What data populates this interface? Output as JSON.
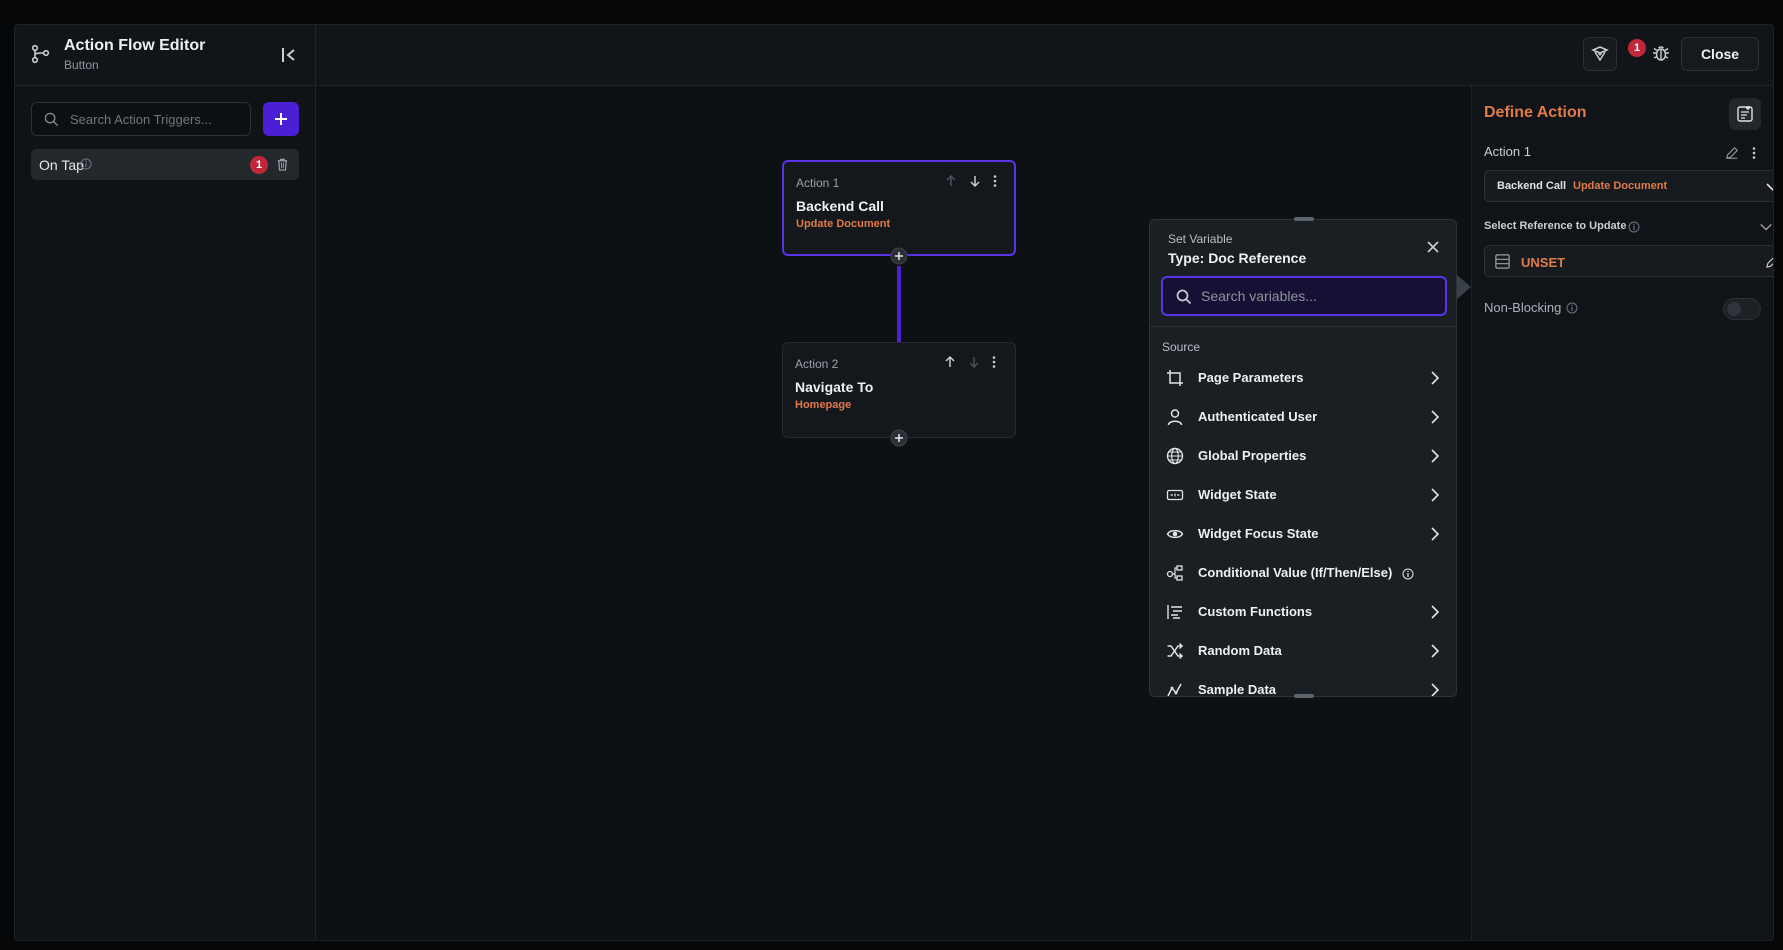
{
  "header": {
    "title": "Action Flow Editor",
    "subtitle": "Button",
    "badge_count": "1",
    "close_label": "Close"
  },
  "triggers": {
    "search_placeholder": "Search Action Triggers...",
    "items": [
      {
        "label": "On Tap",
        "badge": "1"
      }
    ]
  },
  "actions": [
    {
      "label": "Action 1",
      "title": "Backend Call",
      "subtitle": "Update Document"
    },
    {
      "label": "Action 2",
      "title": "Navigate To",
      "subtitle": "Homepage"
    }
  ],
  "variable_picker": {
    "label": "Set Variable",
    "title": "Type: Doc Reference",
    "search_placeholder": "Search variables...",
    "section": "Source",
    "items": [
      {
        "label": "Page Parameters",
        "icon": "page-parameters-icon"
      },
      {
        "label": "Authenticated User",
        "icon": "user-icon"
      },
      {
        "label": "Global Properties",
        "icon": "globe-icon"
      },
      {
        "label": "Widget State",
        "icon": "widget-state-icon"
      },
      {
        "label": "Widget Focus State",
        "icon": "eye-icon"
      },
      {
        "label": "Conditional Value (If/Then/Else)",
        "icon": "conditional-icon"
      },
      {
        "label": "Custom Functions",
        "icon": "custom-functions-icon"
      },
      {
        "label": "Random Data",
        "icon": "shuffle-icon"
      },
      {
        "label": "Sample Data",
        "icon": "sample-data-icon"
      }
    ]
  },
  "define_action": {
    "title": "Define Action",
    "action_label": "Action 1",
    "select_type": "Backend Call",
    "select_value": "Update Document",
    "reference_label": "Select Reference to Update",
    "reference_value": "UNSET",
    "non_blocking_label": "Non-Blocking",
    "non_blocking_enabled": false
  },
  "colors": {
    "accent": "#4b1fd6",
    "highlight_text": "#e07a48",
    "badge": "#c0283a"
  }
}
